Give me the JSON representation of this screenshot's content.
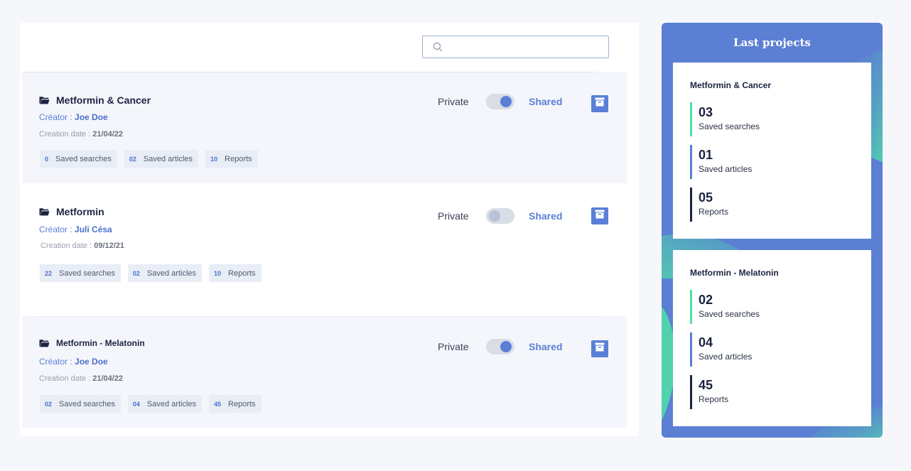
{
  "search": {
    "placeholder": "",
    "value": ""
  },
  "projects": [
    {
      "title": "Metformin & Cancer",
      "creator_label": "Créator :",
      "creator_name": "Joe Doe",
      "date_label": "Creation date :",
      "date": "21/04/22",
      "chips": [
        {
          "num": "0",
          "label": "Saved searches"
        },
        {
          "num": "02",
          "label": "Saved articles"
        },
        {
          "num": "10",
          "label": "Reports"
        }
      ],
      "private_label": "Private",
      "shared_label": "Shared",
      "shared": true
    },
    {
      "title": "Metformin",
      "creator_label": "Créator :",
      "creator_name": "Juli Césa",
      "date_label": "Creation date :",
      "date": "09/12/21",
      "chips": [
        {
          "num": "22",
          "label": "Saved searches"
        },
        {
          "num": "02",
          "label": "Saved articles"
        },
        {
          "num": "10",
          "label": "Reports"
        }
      ],
      "private_label": "Private",
      "shared_label": "Shared",
      "shared": false
    },
    {
      "title": "Metformin - Melatonin",
      "creator_label": "Créator :",
      "creator_name": "Joe Doe",
      "date_label": "Creation date :",
      "date": "21/04/22",
      "chips": [
        {
          "num": "02",
          "label": "Saved searches"
        },
        {
          "num": "04",
          "label": "Saved articles"
        },
        {
          "num": "45",
          "label": "Reports"
        }
      ],
      "private_label": "Private",
      "shared_label": "Shared",
      "shared": true
    }
  ],
  "sidebar": {
    "title": "Last projects",
    "cards": [
      {
        "title": "Metformin & Cancer",
        "stats": [
          {
            "value": "03",
            "label": "Saved searches"
          },
          {
            "value": "01",
            "label": "Saved articles"
          },
          {
            "value": "05",
            "label": "Reports"
          }
        ]
      },
      {
        "title": "Metformin - Melatonin",
        "stats": [
          {
            "value": "02",
            "label": "Saved searches"
          },
          {
            "value": "04",
            "label": "Saved articles"
          },
          {
            "value": "45",
            "label": "Reports"
          }
        ]
      }
    ]
  },
  "colors": {
    "accent": "#5a7fd6",
    "panel": "#5b7fd3",
    "green": "#4fe0a6",
    "dark": "#1c2340"
  }
}
